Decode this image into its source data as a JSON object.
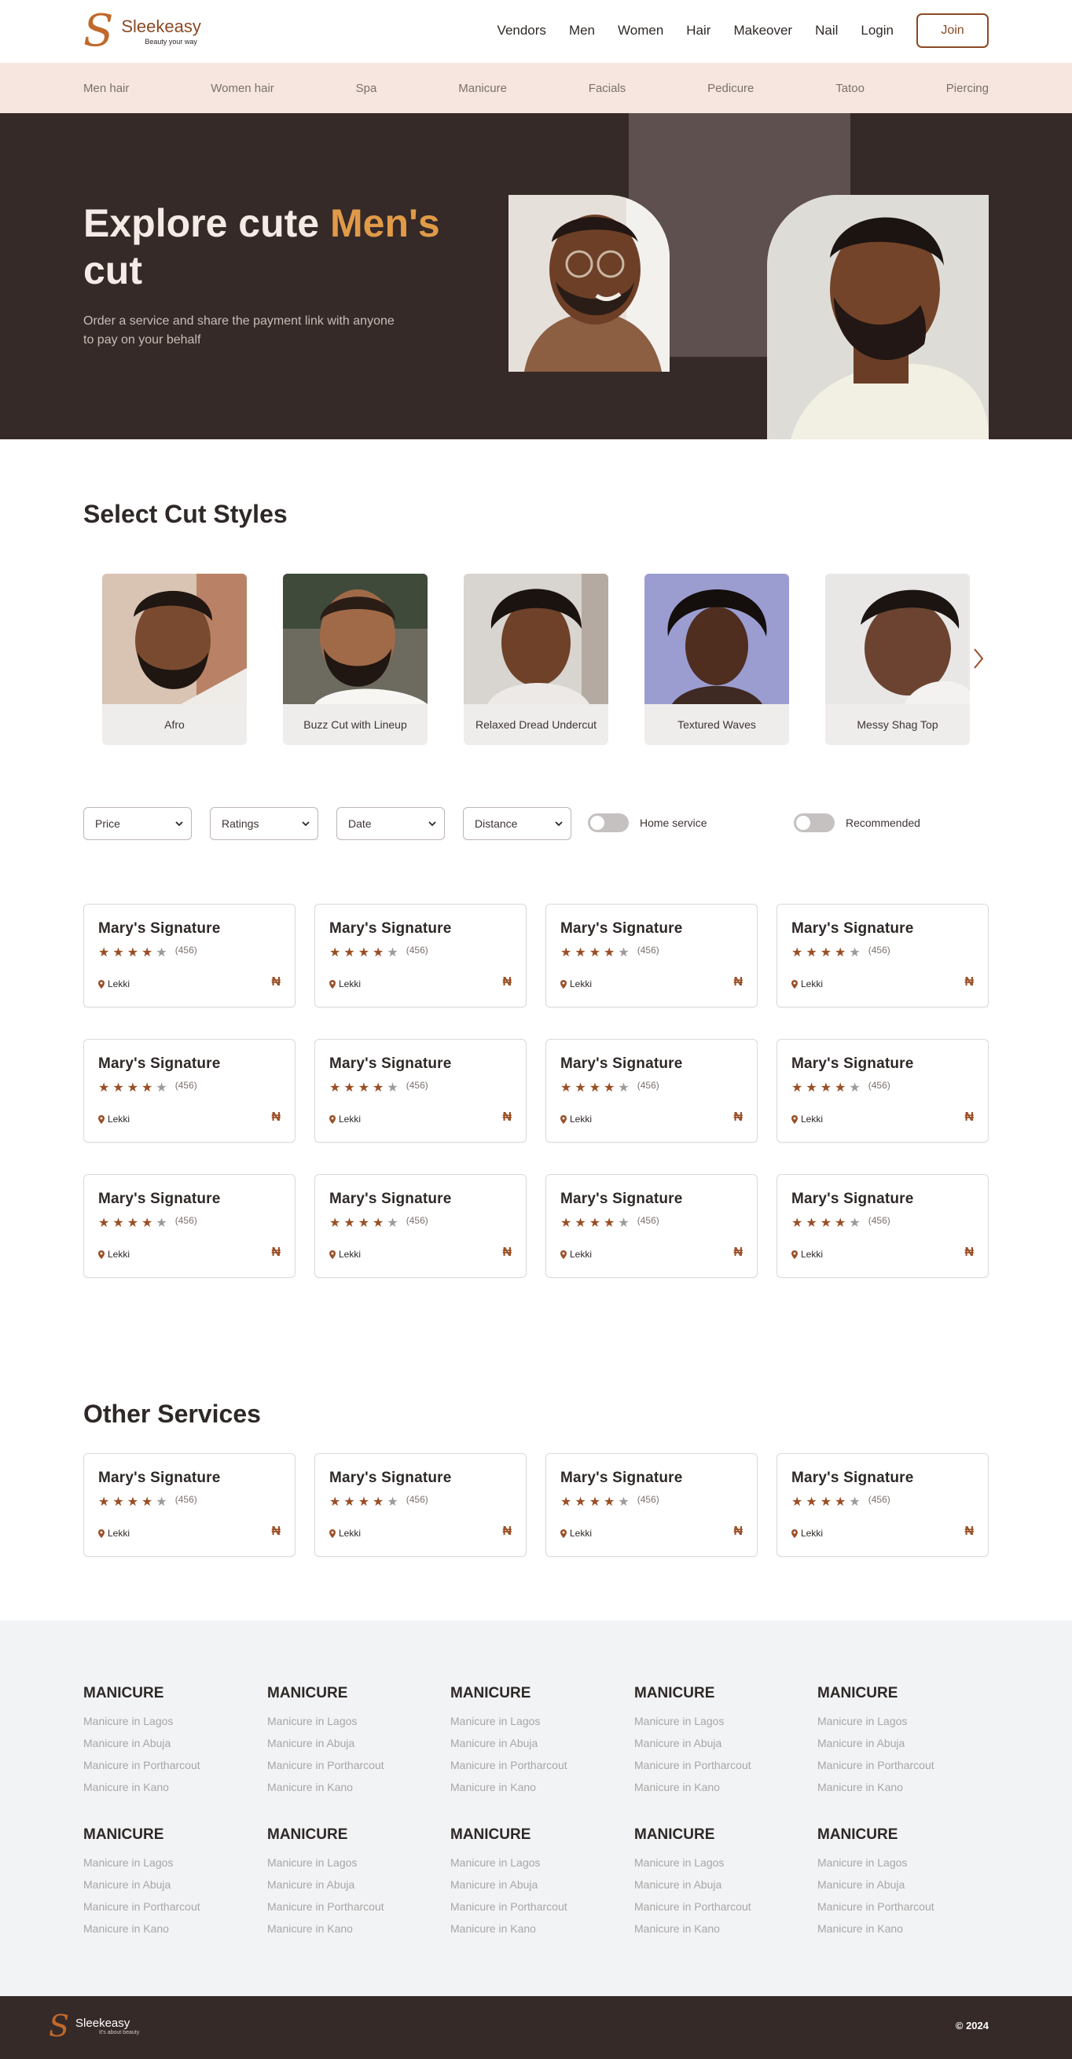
{
  "brand": {
    "name": "Sleekeasy",
    "tagline": "Beauty your way",
    "logo_mark": "S"
  },
  "nav": {
    "links": [
      "Vendors",
      "Men",
      "Women",
      "Hair",
      "Makeover",
      "Nail",
      "Login"
    ],
    "join_label": "Join"
  },
  "categories": [
    "Men hair",
    "Women hair",
    "Spa",
    "Manicure",
    "Facials",
    "Pedicure",
    "Tatoo",
    "Piercing"
  ],
  "hero": {
    "title_part1": "Explore cute ",
    "title_accent": "Men's",
    "title_part2": "cut",
    "subtitle": "Order a service and share the payment link with anyone to pay on your behalf"
  },
  "cut_styles": {
    "title": "Select Cut Styles",
    "items": [
      "Afro",
      "Buzz Cut with Lineup",
      "Relaxed Dread Undercut",
      "Textured Waves",
      "Messy Shag Top"
    ]
  },
  "filters": {
    "selects": [
      "Price",
      "Ratings",
      "Date",
      "Distance"
    ],
    "toggles": [
      "Home service",
      "Recommended"
    ]
  },
  "vendor_card": {
    "name": "Mary's Signature",
    "rating": 4,
    "max_rating": 5,
    "reviews": "(456)",
    "location": "Lekki",
    "currency": "₦"
  },
  "other_services": {
    "title": "Other Services"
  },
  "footer": {
    "column_title": "MANICURE",
    "links": [
      "Manicure in Lagos",
      "Manicure in Abuja",
      "Manicure in Portharcout",
      "Manicure in Kano"
    ],
    "brand_name": "Sleekeasy",
    "brand_tag": "It's about beauty",
    "copyright": "© 2024"
  },
  "colors": {
    "accent": "#9a4e25",
    "hero_bg": "#362a28",
    "hero_accent": "#e09a48",
    "category_bg": "#f6e6df"
  }
}
